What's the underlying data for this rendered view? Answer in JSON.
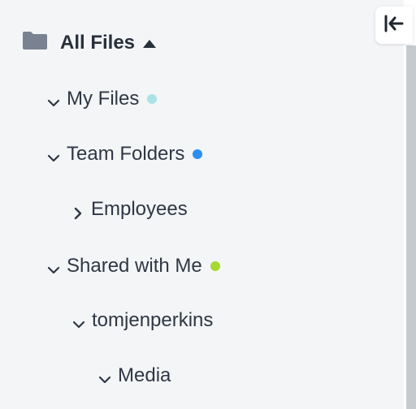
{
  "tree": {
    "root": {
      "label": "All Files"
    },
    "items": [
      {
        "label": "My Files",
        "chevron": "down",
        "dot_color": "#a9e3e6"
      },
      {
        "label": "Team Folders",
        "chevron": "down",
        "dot_color": "#2a8ff0"
      },
      {
        "label": "Employees",
        "chevron": "right",
        "dot_color": null
      },
      {
        "label": "Shared with Me",
        "chevron": "down",
        "dot_color": "#a6d82e"
      },
      {
        "label": "tomjenperkins",
        "chevron": "down",
        "dot_color": null
      },
      {
        "label": "Media",
        "chevron": "down",
        "dot_color": null
      }
    ]
  },
  "icons": {
    "folder": "folder-icon",
    "root_toggle": "caret-up-icon",
    "collapse": "collapse-left-icon"
  }
}
